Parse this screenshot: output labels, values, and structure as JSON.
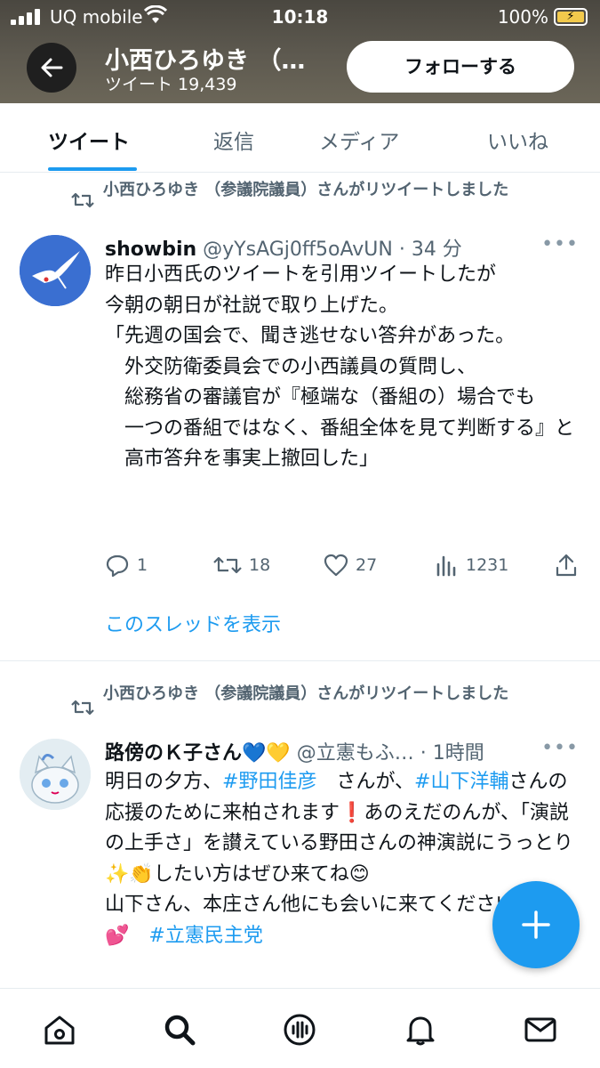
{
  "status_bar": {
    "carrier": "UQ mobile",
    "time": "10:18",
    "battery": "100%"
  },
  "header": {
    "name": "小西ひろゆき （…",
    "tweet_count": "ツイート 19,439",
    "follow_label": "フォローする"
  },
  "tabs": [
    {
      "label": "ツイート",
      "active": true
    },
    {
      "label": "返信"
    },
    {
      "label": "メディア"
    },
    {
      "label": "いいね"
    }
  ],
  "tweets": [
    {
      "retweet_line": "小西ひろゆき （参議院議員）さんがリツイートしました",
      "author_name": "showbin",
      "author_meta": " @yYsAGj0ff5oAvUN · 34 分",
      "text": "昨日小西氏のツイートを引用ツイートしたが\n今朝の朝日が社説で取り上げた。\n「先週の国会で、聞き逃せない答弁があった。\n　外交防衛委員会での小西議員の質問し、\n　総務省の審議官が『極端な（番組の）場合でも\n　一つの番組ではなく、番組全体を見て判断する』と\n　高市答弁を事実上撤回した」",
      "replies": "1",
      "retweets": "18",
      "likes": "27",
      "views": "1231",
      "thread_link": "このスレッドを表示"
    },
    {
      "retweet_line": "小西ひろゆき （参議院議員）さんがリツイートしました",
      "author_name": "路傍のＫ子さん💙💛",
      "author_meta": " @立憲もふ… · 1時間",
      "text_1": "明日の夕方、",
      "hashtag_1": "#野田佳彦",
      "text_2": "　さんが、",
      "hashtag_2": "#山下洋輔",
      "text_3": "さんの応援のために来柏されます❗あのえだのんが、「演説の上手さ」を讃えている野田さんの神演説にうっとり✨👏したい方はぜひ来てね😊\n山下さん、本庄さん他にも会いに来てくださいませ💕　",
      "hashtag_3": "#立憲民主党"
    }
  ],
  "colors": {
    "accent": "#1d9bf0",
    "secondary_text": "#536471"
  }
}
